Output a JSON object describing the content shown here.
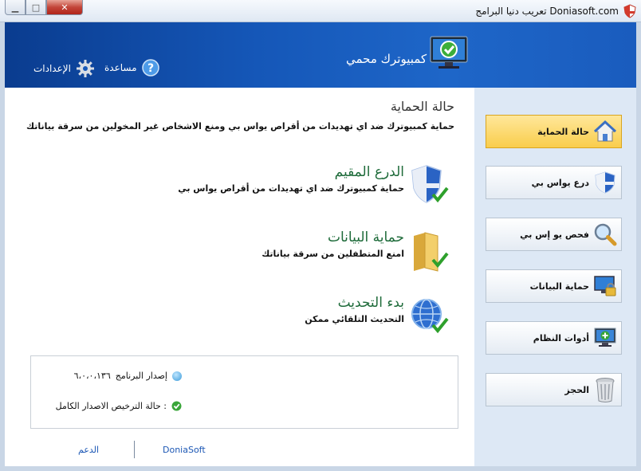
{
  "window": {
    "title": "تعريب دنيا البرامج Doniasoft.com",
    "buttons": {
      "minimize": "▁",
      "maximize": "□",
      "close": "✕"
    }
  },
  "header": {
    "status": "كمبيوترك محمي",
    "help_label": "مساعدة",
    "settings_label": "الإعدادات"
  },
  "main": {
    "title": "حالة الحماية",
    "description": "حماية كمبيوترك ضد اي تهديدات من أقراص يواس بي ومنع الاشخاص غير المخولين من سرقة بياناتك",
    "features": [
      {
        "title": "الدرع المقيم",
        "desc": "حماية كمبيوترك ضد اي تهديدات من أقراص يواس بي",
        "icon": "shield-check-icon"
      },
      {
        "title": "حماية البيانات",
        "desc": "امنع المتطفلين من سرقة بياناتك",
        "icon": "folder-check-icon"
      },
      {
        "title": "بدء التحديث",
        "desc": "التحديث التلقائي ممكن",
        "icon": "globe-check-icon"
      }
    ],
    "info": {
      "version_label": "إصدار البرنامج",
      "version_value": "٦،٠،٠،١٣٦",
      "license_label": "حالة الترخيص الاصدار الكامل :"
    },
    "footer": {
      "support": "الدعم",
      "brand": "DoniaSoft"
    }
  },
  "sidebar": {
    "items": [
      {
        "label": "حالة الحماية",
        "icon": "house-shield-icon",
        "active": true
      },
      {
        "label": "درع يواس بي",
        "icon": "shield-icon",
        "active": false
      },
      {
        "label": "فحص يو إس بي",
        "icon": "magnifier-icon",
        "active": false
      },
      {
        "label": "حماية البيانات",
        "icon": "monitor-lock-icon",
        "active": false
      },
      {
        "label": "أدوات النظام",
        "icon": "monitor-plus-icon",
        "active": false
      },
      {
        "label": "الحجز",
        "icon": "trash-icon",
        "active": false
      }
    ]
  },
  "colors": {
    "header": "#1557b8",
    "accent_green": "#1e6b3a",
    "active_nav": "#f9cd4c",
    "sidebar_bg": "#dde8f5"
  }
}
